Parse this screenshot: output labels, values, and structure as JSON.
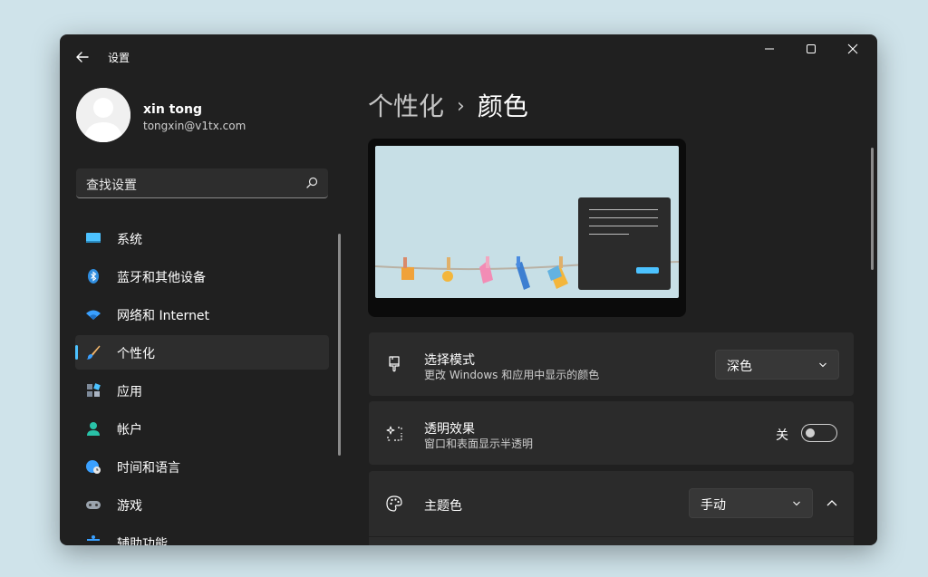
{
  "window": {
    "title": "设置",
    "controls": {
      "minimize": "minimize-icon",
      "maximize": "maximize-icon",
      "close": "close-icon"
    }
  },
  "user": {
    "name": "xin tong",
    "email": "tongxin@v1tx.com"
  },
  "search": {
    "value": "查找设置"
  },
  "sidebar": {
    "items": [
      {
        "label": "系统",
        "icon": "system-icon",
        "active": false
      },
      {
        "label": "蓝牙和其他设备",
        "icon": "bluetooth-icon",
        "active": false
      },
      {
        "label": "网络和 Internet",
        "icon": "wifi-icon",
        "active": false
      },
      {
        "label": "个性化",
        "icon": "brush-icon",
        "active": true
      },
      {
        "label": "应用",
        "icon": "apps-icon",
        "active": false
      },
      {
        "label": "帐户",
        "icon": "account-icon",
        "active": false
      },
      {
        "label": "时间和语言",
        "icon": "globe-clock-icon",
        "active": false
      },
      {
        "label": "游戏",
        "icon": "gamepad-icon",
        "active": false
      },
      {
        "label": "辅助功能",
        "icon": "accessibility-icon",
        "active": false
      }
    ]
  },
  "breadcrumb": {
    "parent": "个性化",
    "separator": "›",
    "current": "颜色"
  },
  "settings": {
    "mode": {
      "title": "选择模式",
      "subtitle": "更改 Windows 和应用中显示的颜色",
      "value": "深色",
      "icon": "brush-mode-icon"
    },
    "transparency": {
      "title": "透明效果",
      "subtitle": "窗口和表面显示半透明",
      "state_label": "关",
      "on": false,
      "icon": "sparkle-icon"
    },
    "accent": {
      "title": "主题色",
      "value": "手动",
      "icon": "palette-icon",
      "expanded": true
    }
  },
  "colors": {
    "accent": "#4cc2ff",
    "window_bg": "#202020",
    "card_bg": "#2b2b2b"
  }
}
